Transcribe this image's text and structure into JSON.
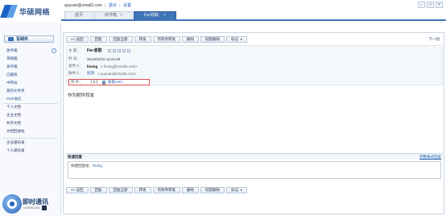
{
  "app": {
    "brand": "华硕网络",
    "user_email": "quyuan@zmail3.com",
    "logout": "退出",
    "settings": "设置"
  },
  "window_buttons": [
    "–",
    "□",
    "×"
  ],
  "tabs": [
    {
      "label": "首页",
      "close": ""
    },
    {
      "label": "收件箱",
      "close": "×"
    },
    {
      "label": "Fw:收取",
      "close": "×"
    }
  ],
  "sidebar": {
    "compose": "写邮件",
    "items": [
      "收件箱",
      "草稿箱",
      "发件箱",
      "已删除",
      "中转站",
      "我的文件夹",
      "POP收信"
    ],
    "tools": [
      "个人文档",
      "企业文档",
      "共享文档",
      "文档回收站"
    ],
    "contacts": [
      "企业通讯录",
      "个人通讯录"
    ],
    "chat_title": "即时通讯",
    "chat_sub": "DOWNLOAD"
  },
  "toolbar": {
    "back": "<< 返回",
    "reply": "回复",
    "reply_all": "回复全部",
    "forward": "转发",
    "forward_attach": "作附件转发",
    "delete": "删除",
    "delete_perm": "彻底删除",
    "mark": "标记",
    "mark_caret": "▼",
    "next": "下一封"
  },
  "mail": {
    "subject_label": "主  题：",
    "subject": "Fw:收取",
    "time_label": "时  间：",
    "time": "2013/01/15 13:44:49",
    "sender_label": "发件人：",
    "sender_name": "liming",
    "sender_addr": "< liming@zmail3.com>",
    "recipient_label": "收件人：",
    "recipient_name": "屈源",
    "recipient_addr": "< quyuan@zmail3.com>",
    "attach_label": "附  件：",
    "attach_paren": "（ 1 ）",
    "attach_name": "收取.eml ;",
    "body": "作为附件转发"
  },
  "quick_reply": {
    "title": "快速回复",
    "full_reply": "完整格式回复",
    "to_prefix": "快捷回复给：",
    "to": "liming"
  }
}
